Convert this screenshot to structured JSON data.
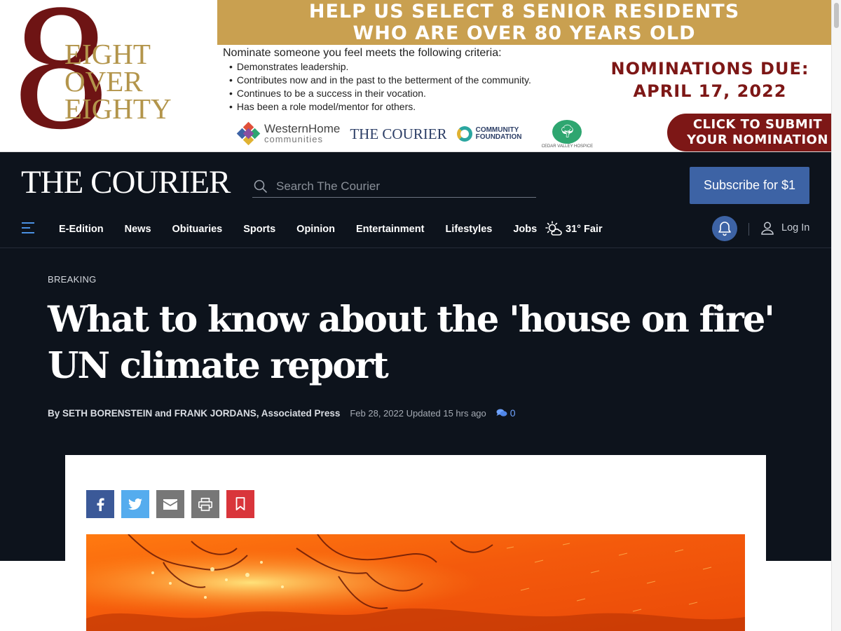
{
  "ad": {
    "logo_numeral": "8",
    "logo_words": [
      "EIGHT",
      "OVER",
      "EIGHTY"
    ],
    "headline_line1": "HELP US SELECT 8 SENIOR RESIDENTS",
    "headline_line2": "WHO ARE OVER 80 YEARS OLD",
    "criteria_intro": "Nominate someone you feel meets the following criteria:",
    "criteria": [
      "Demonstrates leadership.",
      "Contributes now and in the past to the betterment of the community.",
      "Continues to be a success in their vocation.",
      "Has been a role model/mentor for others."
    ],
    "due_line1": "NOMINATIONS DUE:",
    "due_line2": "APRIL 17, 2022",
    "sponsors": {
      "western_home": "WesternHome",
      "western_home_sub": "communities",
      "courier": "THE COURIER",
      "community_foundation": "COMMUNITY FOUNDATION",
      "cedar_valley": "CEDAR VALLEY HOSPICE"
    },
    "cta_line1": "CLICK TO SUBMIT",
    "cta_line2": "YOUR NOMINATION",
    "colors": {
      "gold": "#c9a050",
      "maroon": "#7d1716"
    }
  },
  "header": {
    "masthead": "THE COURIER",
    "search_placeholder": "Search The Courier",
    "subscribe_label": "Subscribe for $1",
    "colors": {
      "background": "#0d131c",
      "accent": "#3d63a5"
    }
  },
  "nav": {
    "menu_icon": "hamburger-icon",
    "items": [
      "E-Edition",
      "News",
      "Obituaries",
      "Sports",
      "Opinion",
      "Entertainment",
      "Lifestyles",
      "Jobs"
    ],
    "weather": {
      "icon": "partly-sunny-icon",
      "text": "31° Fair"
    },
    "notifications_icon": "bell-icon",
    "login_label": "Log In"
  },
  "article": {
    "kicker": "BREAKING",
    "headline": "What to know about the 'house on fire' UN climate report",
    "byline": "By SETH BORENSTEIN and FRANK JORDANS, Associated Press",
    "date": "Feb 28, 2022 Updated 15 hrs ago",
    "comment_count": "0",
    "share": [
      {
        "icon": "facebook-icon",
        "color": "#3b5998"
      },
      {
        "icon": "twitter-icon",
        "color": "#55acee"
      },
      {
        "icon": "email-icon",
        "color": "#777777"
      },
      {
        "icon": "print-icon",
        "color": "#777777"
      },
      {
        "icon": "bookmark-icon",
        "color": "#d9353b"
      }
    ]
  }
}
